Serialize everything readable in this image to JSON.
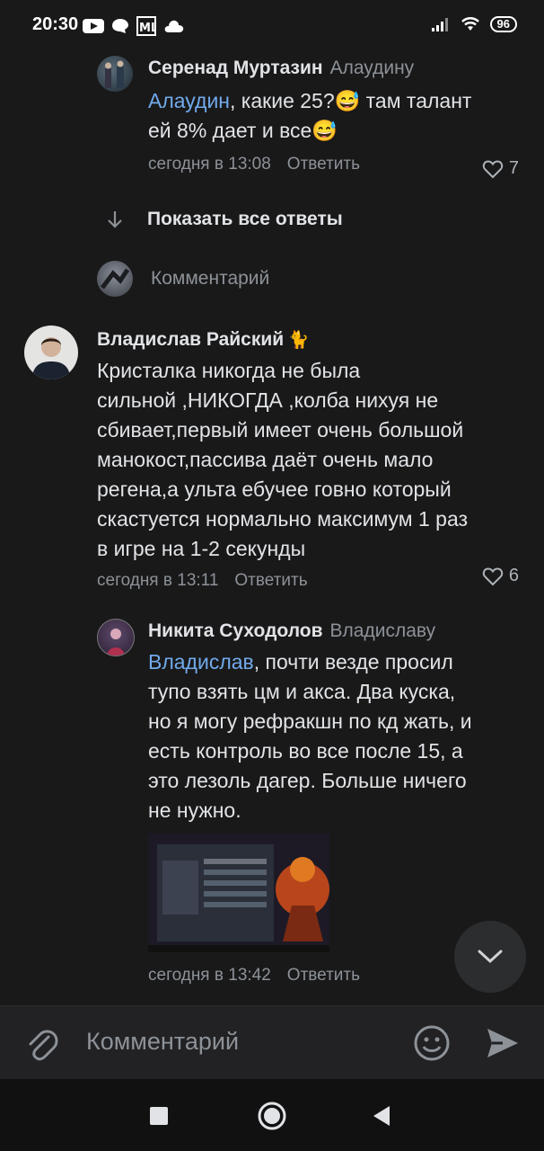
{
  "status_bar": {
    "time": "20:30",
    "battery": "96"
  },
  "comment1": {
    "author": "Серенад Муртазин",
    "reply_to": "Алаудину",
    "mention": "Алаудин",
    "text_line1_rest": ", какие 25?",
    "text_line1_after_emoji": " там талант",
    "text_line2": "ей 8% дает и все",
    "emoji": "😅",
    "time": "сегодня в 13:08",
    "reply_label": "Ответить",
    "likes": "7"
  },
  "show_all_replies": "Показать все ответы",
  "inline_comment_placeholder": "Комментарий",
  "comment2": {
    "author": "Владислав Райский",
    "author_emoji": "🐈",
    "text_lines": [
      "Кристалка никогда не была",
      "сильной ,НИКОГДА ,колба нихуя не",
      "сбивает,первый имеет очень большой",
      "манокост,пассива даёт очень мало",
      "регена,а ульта ебучее говно который",
      "скастуется нормально максимум 1 раз",
      "в игре на 1-2 секунды"
    ],
    "time": "сегодня в 13:11",
    "reply_label": "Ответить",
    "likes": "6"
  },
  "comment3": {
    "author": "Никита Суходолов",
    "reply_to": "Владиславу",
    "mention": "Владислав",
    "text_line1_rest": ", почти везде просил",
    "text_lines": [
      "тупо взять цм и акса. Два куска,",
      "но я могу рефракшн по кд жать, и",
      "есть контроль во все после 15, а",
      "это лезоль дагер. Больше ничего",
      "не нужно."
    ],
    "time": "сегодня в 13:42",
    "reply_label": "Ответить"
  },
  "bottom_input": {
    "placeholder": "Комментарий"
  },
  "colors": {
    "background": "#19191a",
    "link": "#71aaeb",
    "secondary": "#8d9298",
    "input_bg": "#222224"
  }
}
